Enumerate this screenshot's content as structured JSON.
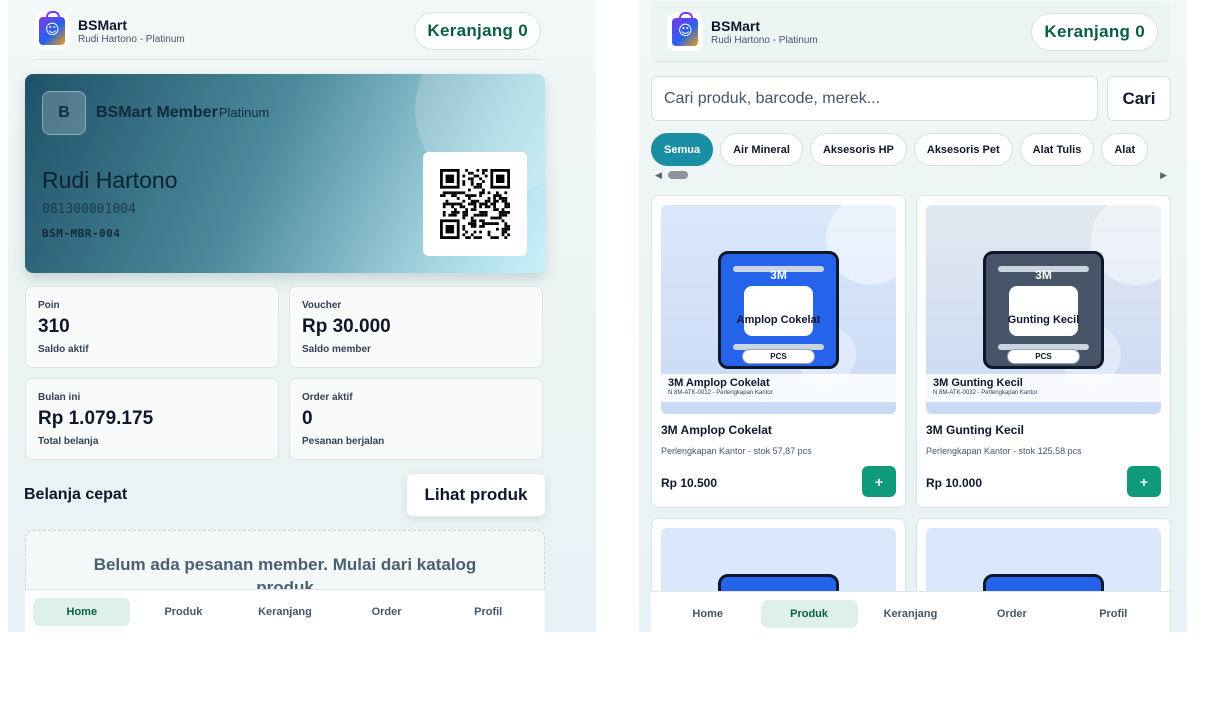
{
  "brand": {
    "name": "BSMart",
    "subtitle": "Rudi Hartono - Platinum"
  },
  "cart": {
    "label": "Keranjang 0"
  },
  "member_card": {
    "badge": "B",
    "title": "BSMart Member",
    "tier": "Platinum",
    "name": "Rudi Hartono",
    "phone": "081300001004",
    "code": "BSM-MBR-004"
  },
  "stats": [
    {
      "label": "Poin",
      "value": "310",
      "sub": "Saldo aktif"
    },
    {
      "label": "Voucher",
      "value": "Rp 30.000",
      "sub": "Saldo member"
    },
    {
      "label": "Bulan ini",
      "value": "Rp 1.079.175",
      "sub": "Total belanja"
    },
    {
      "label": "Order aktif",
      "value": "0",
      "sub": "Pesanan berjalan"
    }
  ],
  "quick": {
    "title": "Belanja cepat",
    "button": "Lihat produk"
  },
  "empty_message": "Belum ada pesanan member. Mulai dari katalog produk",
  "nav": {
    "items": [
      "Home",
      "Produk",
      "Keranjang",
      "Order",
      "Profil"
    ],
    "left_active": "Home",
    "right_active": "Produk"
  },
  "search": {
    "placeholder": "Cari produk, barcode, merek...",
    "button": "Cari"
  },
  "categories": [
    "Semua",
    "Air Mineral",
    "Aksesoris HP",
    "Aksesoris Pet",
    "Alat Tulis",
    "Alat"
  ],
  "products": [
    {
      "brand": "3M",
      "image_name": "Amplop Cokelat",
      "unit": "PCS",
      "label_title": "3M Amplop Cokelat",
      "label_sub": "N 8M-ATK-0012 - Perlengkapan Kantor",
      "name": "3M Amplop Cokelat",
      "meta": "Perlengkapan Kantor - stok 57,87 pcs",
      "price": "Rp 10.500",
      "box_color": "#2563eb",
      "bg_color": "#dbe8fb"
    },
    {
      "brand": "3M",
      "image_name": "Gunting Kecil",
      "unit": "PCS",
      "label_title": "3M Gunting Kecil",
      "label_sub": "N 8M-ATK-0032 - Perlengkapan Kantor",
      "name": "3M Gunting Kecil",
      "meta": "Perlengkapan Kantor - stok 125,58 pcs",
      "price": "Rp 10.000",
      "box_color": "#475569",
      "bg_color": "#e2e8ef"
    }
  ],
  "add_symbol": "+",
  "icons": {
    "logo": "shopping-bag-icon",
    "qr": "qr-code-icon",
    "add": "plus-icon"
  }
}
